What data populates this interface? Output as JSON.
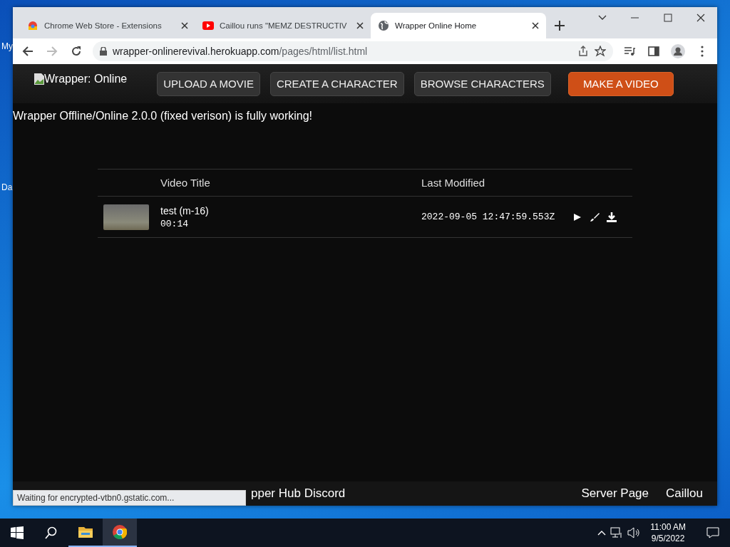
{
  "desktop": {
    "icon_labels": [
      "My",
      "Da"
    ]
  },
  "browser": {
    "tabs": [
      {
        "title": "Chrome Web Store - Extensions",
        "selected": false
      },
      {
        "title": "Caillou runs \"MEMZ DESTRUCTIV",
        "selected": false
      },
      {
        "title": "Wrapper Online Home",
        "selected": true
      }
    ],
    "address": {
      "host": "wrapper-onlinerevival.herokuapp.com",
      "path": "/pages/html/list.html"
    },
    "status_bubble": "Waiting for encrypted-vtbn0.gstatic.com..."
  },
  "page": {
    "logo_alt": "Wrapper: Online",
    "nav_buttons": [
      {
        "label": "UPLOAD A MOVIE",
        "primary": false
      },
      {
        "label": "CREATE A CHARACTER",
        "primary": false
      },
      {
        "label": "BROWSE CHARACTERS",
        "primary": false
      },
      {
        "label": "MAKE A VIDEO",
        "primary": true
      }
    ],
    "notice": "Wrapper Offline/Online 2.0.0 (fixed verison) is fully working!",
    "table": {
      "columns": [
        "Video Title",
        "Last Modified"
      ],
      "rows": [
        {
          "title": "test (m-16)",
          "duration": "00:14",
          "modified": "2022-09-05 12:47:59.553Z"
        }
      ]
    },
    "footer": {
      "left_links": [
        "pper Hub Discord"
      ],
      "right_links": [
        "Server Page",
        "Caillou"
      ]
    }
  },
  "taskbar": {
    "time": "11:00 AM",
    "date": "9/5/2022"
  }
}
